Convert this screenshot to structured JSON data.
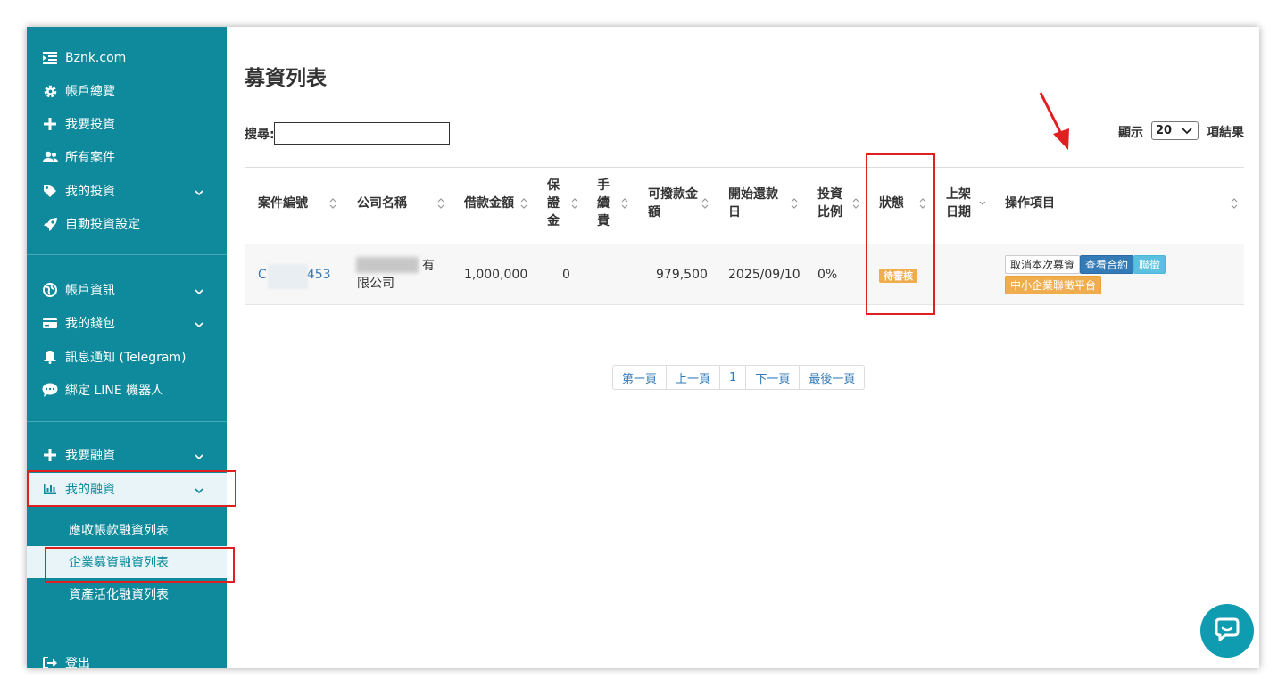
{
  "sidebar": {
    "brand": "Bznk.com",
    "items": [
      {
        "label": "帳戶總覽"
      },
      {
        "label": "我要投資"
      },
      {
        "label": "所有案件"
      },
      {
        "label": "我的投資"
      },
      {
        "label": "自動投資設定"
      },
      {
        "label": "帳戶資訊"
      },
      {
        "label": "我的錢包"
      },
      {
        "label": "訊息通知 (Telegram)"
      },
      {
        "label": "綁定 LINE 機器人"
      },
      {
        "label": "我要融資"
      },
      {
        "label": "我的融資"
      }
    ],
    "sub_items": [
      {
        "label": "應收帳款融資列表"
      },
      {
        "label": "企業募資融資列表"
      },
      {
        "label": "資產活化融資列表"
      }
    ],
    "logout": "登出"
  },
  "main": {
    "title": "募資列表",
    "search_label": "搜尋:",
    "show_label": "顯示",
    "page_size": "20",
    "show_suffix": "項結果"
  },
  "table": {
    "headers": {
      "case_no": "案件編號",
      "company": "公司名稱",
      "loan_amount": "借款金額",
      "deposit": [
        "保",
        "證",
        "金"
      ],
      "fee": [
        "手",
        "續",
        "費"
      ],
      "disbursable": [
        "可撥款金",
        "額"
      ],
      "repay_start": [
        "開始還款",
        "日"
      ],
      "invest_ratio": [
        "投資",
        "比例"
      ],
      "status": "狀態",
      "listed_date": [
        "上架",
        "日期"
      ],
      "actions": "操作項目"
    },
    "row": {
      "case_prefix": "C",
      "case_suffix": "453",
      "company_line1": "有",
      "company_line2": "限公司",
      "loan_amount": "1,000,000",
      "deposit": "0",
      "disbursable": "979,500",
      "repay_start": "2025/09/10",
      "invest_ratio": "0%",
      "status": "待審核"
    },
    "actions": {
      "cancel": "取消本次募資",
      "view_contract": "查看合約",
      "credit_check": "聯徵",
      "sme_platform": "中小企業聯徵平台"
    }
  },
  "pagination": {
    "first": "第一頁",
    "prev": "上一頁",
    "current": "1",
    "next": "下一頁",
    "last": "最後一頁"
  },
  "colors": {
    "sidebar": "#0e8a9c",
    "link": "#337ab7",
    "warning": "#f0ad4e",
    "highlight": "#e02020"
  }
}
